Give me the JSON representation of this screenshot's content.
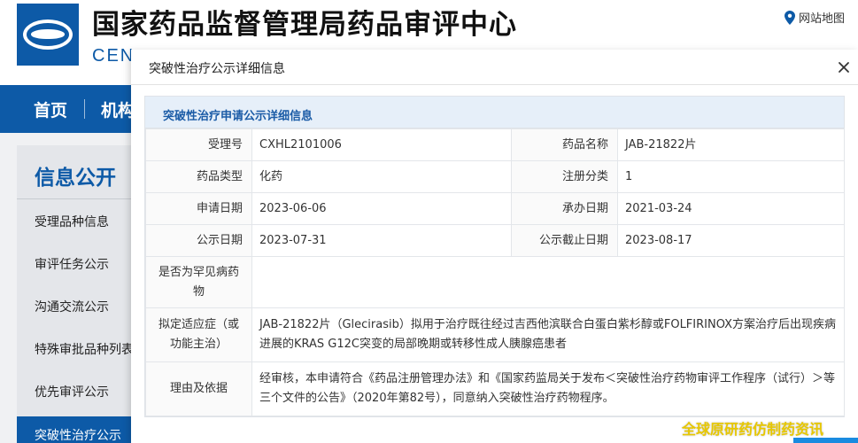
{
  "site": {
    "title": "国家药品监督管理局药品审评中心",
    "subtitle": "CEN",
    "sitemap_label": "网站地图"
  },
  "nav": {
    "items": [
      "首页",
      "机构"
    ]
  },
  "sidebar": {
    "title": "信息公开",
    "items": [
      "受理品种信息",
      "审评任务公示",
      "沟通交流公示",
      "特殊审批品种列表",
      "优先审评公示",
      "突破性治疗公示"
    ],
    "active_index": 5
  },
  "modal": {
    "title": "突破性治疗公示详细信息",
    "panel_title": "突破性治疗申请公示详细信息",
    "fields": {
      "acceptance_no_label": "受理号",
      "acceptance_no": "CXHL2101006",
      "drug_name_label": "药品名称",
      "drug_name": "JAB-21822片",
      "drug_type_label": "药品类型",
      "drug_type": "化药",
      "reg_class_label": "注册分类",
      "reg_class": "1",
      "apply_date_label": "申请日期",
      "apply_date": "2023-06-06",
      "undertake_date_label": "承办日期",
      "undertake_date": "2021-03-24",
      "publish_date_label": "公示日期",
      "publish_date": "2023-07-31",
      "publish_end_label": "公示截止日期",
      "publish_end": "2023-08-17",
      "rare_label": "是否为罕见病药物",
      "rare": "",
      "indication_label": "拟定适应症（或功能主治）",
      "indication": "JAB-21822片（Glecirasib）拟用于治疗既往经过吉西他滨联合白蛋白紫杉醇或FOLFIRINOX方案治疗后出现疾病进展的KRAS G12C突变的局部晚期或转移性成人胰腺癌患者",
      "reason_label": "理由及依据",
      "reason": "经审核，本申请符合《药品注册管理办法》和《国家药监局关于发布＜突破性治疗药物审评工作程序（试行）＞等三个文件的公告》（2020年第82号），同意纳入突破性治疗药物程序。"
    }
  },
  "watermark": "全球原研药仿制药资讯",
  "colors": {
    "brand_blue": "#0d5aa7",
    "panel_header_bg": "#e6eff9",
    "watermark": "#e7c700"
  }
}
